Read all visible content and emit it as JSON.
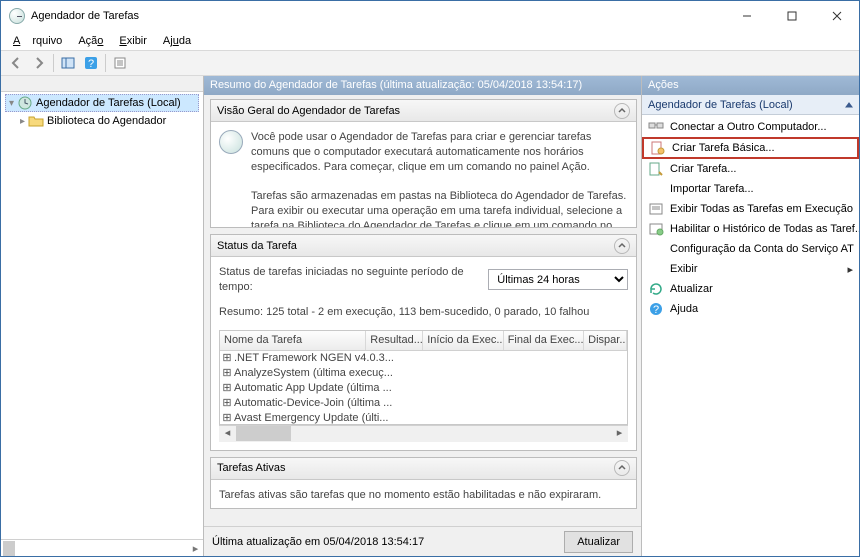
{
  "window": {
    "title": "Agendador de Tarefas"
  },
  "menu": {
    "file": "Arquivo",
    "action": "Ação",
    "view": "Exibir",
    "help": "Ajuda"
  },
  "tree": {
    "root": "Agendador de Tarefas (Local)",
    "library": "Biblioteca do Agendador"
  },
  "summary": {
    "header": "Resumo do Agendador de Tarefas (última atualização: 05/04/2018 13:54:17)"
  },
  "overview": {
    "title": "Visão Geral do Agendador de Tarefas",
    "para1": "Você pode usar o Agendador de Tarefas para criar e gerenciar tarefas comuns que o computador executará automaticamente nos horários especificados. Para começar, clique em um comando no painel Ação.",
    "para2": "Tarefas são armazenadas em pastas na Biblioteca do Agendador de Tarefas. Para exibir ou executar uma operação em uma tarefa individual, selecione a tarefa na Biblioteca do Agendador de Tarefas e clique em um comando no menu Ação"
  },
  "status": {
    "title": "Status da Tarefa",
    "period_label": "Status de tarefas iniciadas no seguinte período de tempo:",
    "period_value": "Últimas 24 horas",
    "summary_line": "Resumo: 125 total - 2 em execução, 113 bem-sucedido, 0 parado, 10 falhou",
    "columns": [
      "Nome da Tarefa",
      "Resultad...",
      "Início da Exec...",
      "Final da Exec...",
      "Dispar..."
    ],
    "rows": [
      ".NET Framework NGEN v4.0.3...",
      "AnalyzeSystem (última execuç...",
      "Automatic App Update (última ...",
      "Automatic-Device-Join (última ...",
      "Avast Emergency Update (últi..."
    ]
  },
  "active": {
    "title": "Tarefas Ativas",
    "desc": "Tarefas ativas são tarefas que no momento estão habilitadas e não expiraram."
  },
  "footer": {
    "last_update": "Última atualização em 05/04/2018 13:54:17",
    "refresh": "Atualizar"
  },
  "actions": {
    "header": "Ações",
    "subheader": "Agendador de Tarefas (Local)",
    "items": [
      {
        "label": "Conectar a Outro Computador...",
        "icon": "connect"
      },
      {
        "label": "Criar Tarefa Básica...",
        "icon": "basic",
        "highlight": true
      },
      {
        "label": "Criar Tarefa...",
        "icon": "create"
      },
      {
        "label": "Importar Tarefa...",
        "icon": "import"
      },
      {
        "label": "Exibir Todas as Tarefas em Execução",
        "icon": "running"
      },
      {
        "label": "Habilitar o Histórico de Todas as Taref...",
        "icon": "history"
      },
      {
        "label": "Configuração da Conta do Serviço AT",
        "icon": "none"
      },
      {
        "label": "Exibir",
        "icon": "none",
        "submenu": true
      },
      {
        "label": "Atualizar",
        "icon": "refresh"
      },
      {
        "label": "Ajuda",
        "icon": "help"
      }
    ]
  }
}
